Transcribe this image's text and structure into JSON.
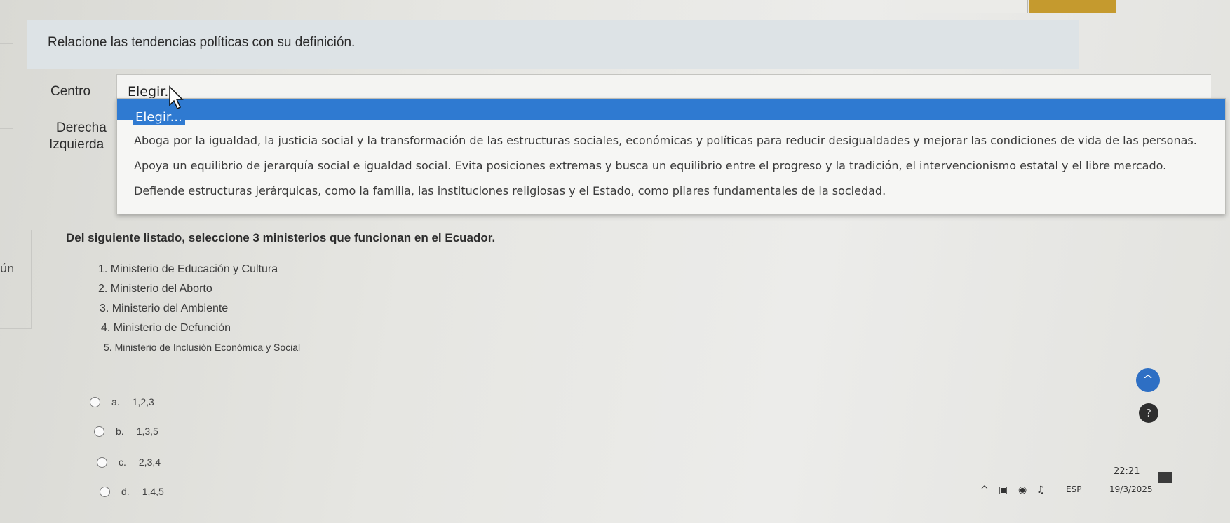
{
  "question1": {
    "prompt": "Relacione las tendencias políticas con su definición.",
    "rows": [
      {
        "label": "Centro",
        "value": "Elegir..."
      },
      {
        "label": "Derecha"
      },
      {
        "label": "Izquierda"
      }
    ],
    "dropdown": {
      "highlighted": "Elegir...",
      "options": [
        "Aboga por la igualdad, la justicia social y la transformación de las estructuras sociales, económicas y políticas para reducir desigualdades y mejorar las condiciones de vida de las personas.",
        "Apoya un equilibrio de jerarquía social e igualdad social. Evita posiciones extremas y busca un equilibrio entre el progreso y la tradición, el intervencionismo estatal y el libre mercado.",
        "Defiende estructuras jerárquicas, como la familia, las instituciones religiosas y el Estado, como pilares fundamentales de la sociedad."
      ]
    }
  },
  "question2": {
    "prompt": "Del siguiente listado, seleccione 3 ministerios que funcionan en el Ecuador.",
    "list": [
      "1. Ministerio de Educación y Cultura",
      "2. Ministerio del Aborto",
      "3. Ministerio del Ambiente",
      "4. Ministerio de Defunción",
      "5. Ministerio de Inclusión Económica y Social"
    ],
    "options": [
      {
        "letter": "a.",
        "value": "1,2,3"
      },
      {
        "letter": "b.",
        "value": "1,3,5"
      },
      {
        "letter": "c.",
        "value": "2,3,4"
      },
      {
        "letter": "d.",
        "value": "1,4,5"
      }
    ]
  },
  "left_edge_text": "ún",
  "buttons": {
    "scroll_top": "^",
    "help": "?"
  },
  "taskbar": {
    "language": "ESP",
    "time": "22:21",
    "date": "19/3/2025"
  },
  "colors": {
    "highlight": "#2f7ad1",
    "accent_orange": "#c59a2e",
    "scroll_button": "#2e6fc4"
  }
}
